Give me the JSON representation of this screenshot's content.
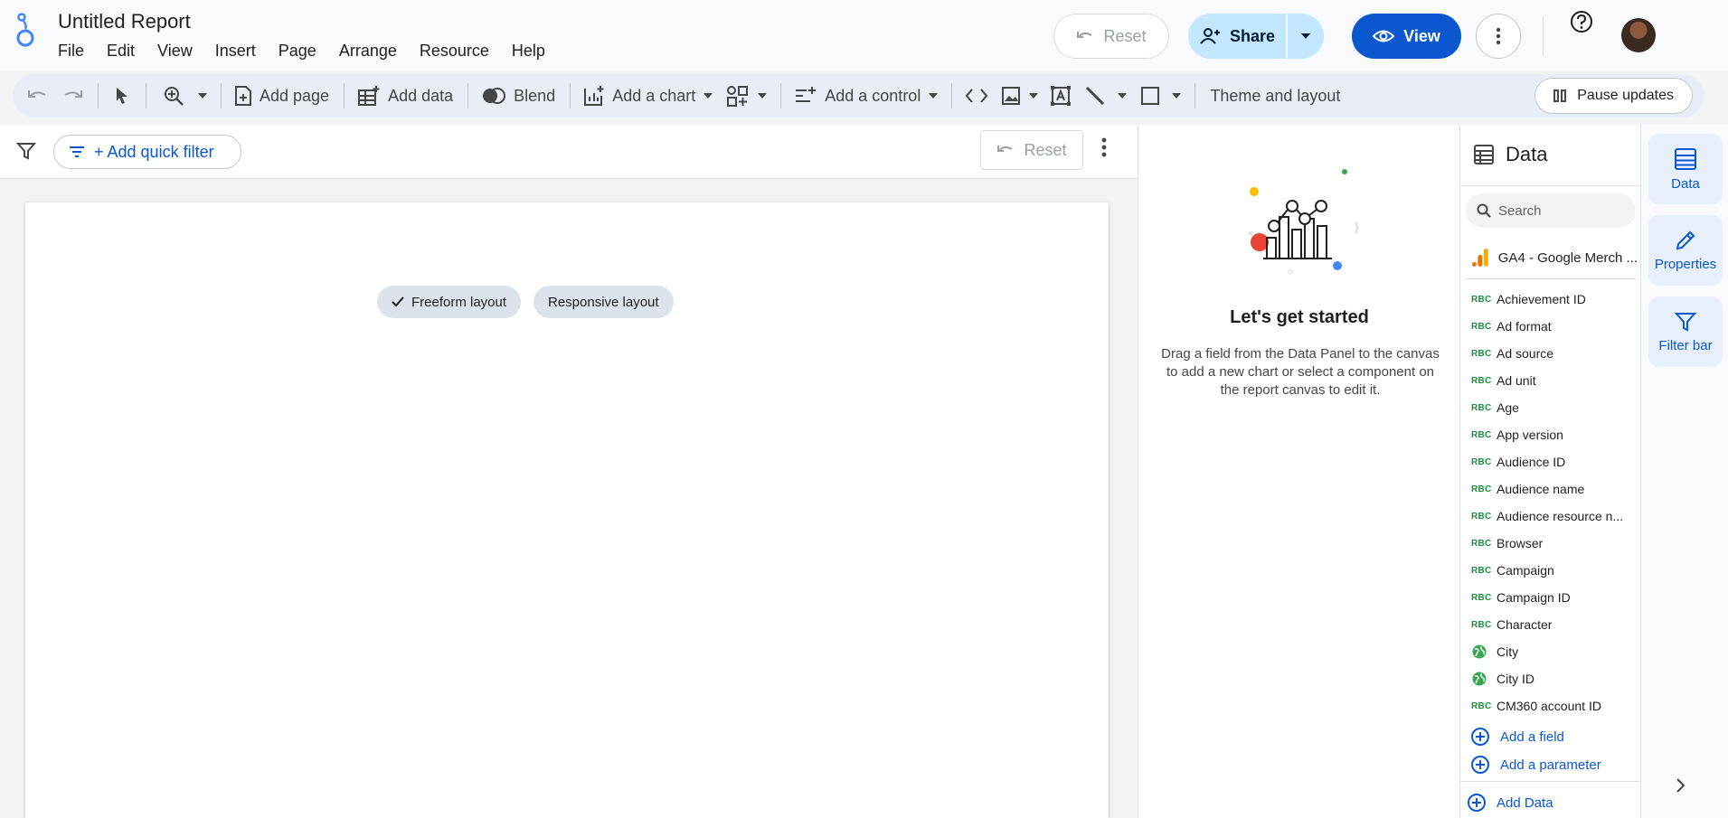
{
  "header": {
    "title": "Untitled Report",
    "menu": [
      "File",
      "Edit",
      "View",
      "Insert",
      "Page",
      "Arrange",
      "Resource",
      "Help"
    ],
    "reset_label": "Reset",
    "share_label": "Share",
    "view_label": "View"
  },
  "toolbar": {
    "add_page": "Add page",
    "add_data": "Add data",
    "blend": "Blend",
    "add_chart": "Add a chart",
    "add_control": "Add a control",
    "theme_layout": "Theme and layout",
    "pause_updates": "Pause updates"
  },
  "filterbar": {
    "quick_filter": "+ Add quick filter",
    "reset_label": "Reset"
  },
  "canvas": {
    "freeform_layout": "Freeform layout",
    "responsive_layout": "Responsive layout"
  },
  "start_panel": {
    "title": "Let's get started",
    "description": "Drag a field from the Data Panel to the canvas to add a new chart or select a component on the report canvas to edit it."
  },
  "data_panel": {
    "title": "Data",
    "search_placeholder": "Search",
    "source": "GA4 - Google Merch ...",
    "fields": [
      {
        "name": "Achievement ID",
        "type": "ABC"
      },
      {
        "name": "Ad format",
        "type": "ABC"
      },
      {
        "name": "Ad source",
        "type": "ABC"
      },
      {
        "name": "Ad unit",
        "type": "ABC"
      },
      {
        "name": "Age",
        "type": "ABC"
      },
      {
        "name": "App version",
        "type": "ABC"
      },
      {
        "name": "Audience ID",
        "type": "ABC"
      },
      {
        "name": "Audience name",
        "type": "ABC"
      },
      {
        "name": "Audience resource n...",
        "type": "ABC"
      },
      {
        "name": "Browser",
        "type": "ABC"
      },
      {
        "name": "Campaign",
        "type": "ABC"
      },
      {
        "name": "Campaign ID",
        "type": "ABC"
      },
      {
        "name": "Character",
        "type": "ABC"
      },
      {
        "name": "City",
        "type": "globe"
      },
      {
        "name": "City ID",
        "type": "globe"
      },
      {
        "name": "CM360 account ID",
        "type": "ABC"
      }
    ],
    "add_field": "Add a field",
    "add_parameter": "Add a parameter",
    "add_data": "Add Data"
  },
  "rail": {
    "data": "Data",
    "properties": "Properties",
    "filter_bar": "Filter bar"
  },
  "colors": {
    "accent": "#0b57d0",
    "share_bg": "#c2e7ff",
    "dimension_green": "#1e8e3e"
  }
}
